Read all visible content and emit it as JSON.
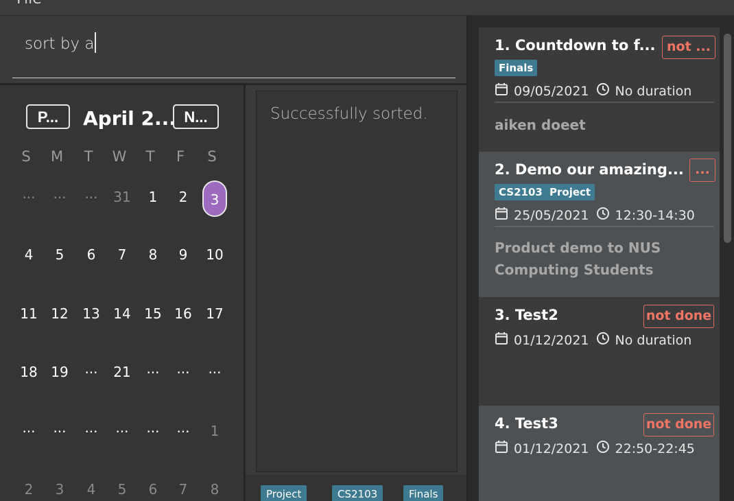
{
  "menu": {
    "file_label": "File"
  },
  "command": {
    "text": "sort by a"
  },
  "result": {
    "message": "Successfully sorted."
  },
  "calendar": {
    "prev_label": "P...",
    "next_label": "N...",
    "month_label": "April 2...",
    "weekdays": [
      "S",
      "M",
      "T",
      "W",
      "T",
      "F",
      "S"
    ],
    "rows": [
      [
        {
          "t": "...",
          "o": true
        },
        {
          "t": "...",
          "o": true
        },
        {
          "t": "...",
          "o": true
        },
        {
          "t": "31",
          "o": true
        },
        {
          "t": "1"
        },
        {
          "t": "2"
        },
        {
          "t": "3",
          "today": true
        }
      ],
      [
        {
          "t": "4"
        },
        {
          "t": "5"
        },
        {
          "t": "6"
        },
        {
          "t": "7"
        },
        {
          "t": "8"
        },
        {
          "t": "9"
        },
        {
          "t": "10"
        }
      ],
      [
        {
          "t": "11"
        },
        {
          "t": "12"
        },
        {
          "t": "13"
        },
        {
          "t": "14"
        },
        {
          "t": "15"
        },
        {
          "t": "16"
        },
        {
          "t": "17"
        }
      ],
      [
        {
          "t": "18"
        },
        {
          "t": "19"
        },
        {
          "t": "..."
        },
        {
          "t": "21"
        },
        {
          "t": "..."
        },
        {
          "t": "..."
        },
        {
          "t": "..."
        }
      ],
      [
        {
          "t": "..."
        },
        {
          "t": "..."
        },
        {
          "t": "..."
        },
        {
          "t": "..."
        },
        {
          "t": "..."
        },
        {
          "t": "..."
        },
        {
          "t": "1",
          "o": true
        }
      ],
      [
        {
          "t": "2",
          "o": true
        },
        {
          "t": "3",
          "o": true
        },
        {
          "t": "4",
          "o": true
        },
        {
          "t": "5",
          "o": true
        },
        {
          "t": "6",
          "o": true
        },
        {
          "t": "7",
          "o": true
        },
        {
          "t": "8",
          "o": true
        }
      ]
    ]
  },
  "tag_bar": [
    "Project",
    "CS2103",
    "Finals"
  ],
  "tasks": [
    {
      "title": "1.  Countdown to f...",
      "status": "not ...",
      "tags": [
        "Finals"
      ],
      "date": "09/05/2021",
      "duration": "No duration",
      "description": "aiken doeet"
    },
    {
      "title": "2.  Demo our amazing...",
      "status": "...",
      "tags": [
        "CS2103",
        "Project"
      ],
      "date": "25/05/2021",
      "duration": "12:30-14:30",
      "description": "Product demo to NUS Computing Students"
    },
    {
      "title": "3.  Test2",
      "status": "not done",
      "tags": [],
      "date": "01/12/2021",
      "duration": "No duration",
      "description": ""
    },
    {
      "title": "4.  Test3",
      "status": "not done",
      "tags": [],
      "date": "01/12/2021",
      "duration": "22:50-22:45",
      "description": ""
    }
  ],
  "colors": {
    "accent_purple": "#9c6bc0",
    "tag_blue": "#3e7b91",
    "status_red": "#f07565"
  },
  "icons": {
    "date": "calendar-icon",
    "time": "clock-icon"
  }
}
